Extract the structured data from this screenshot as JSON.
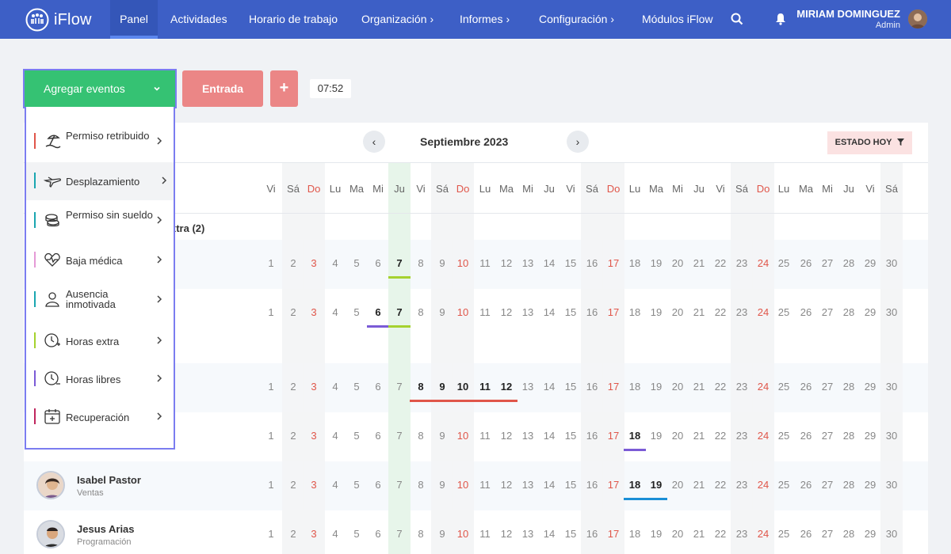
{
  "app": {
    "name": "iFlow"
  },
  "nav": {
    "items": [
      {
        "label": "Panel"
      },
      {
        "label": "Actividades"
      },
      {
        "label": "Horario de trabajo"
      },
      {
        "label": "Organización"
      },
      {
        "label": "Informes"
      },
      {
        "label": "Configuración"
      },
      {
        "label": "Módulos iFlow"
      }
    ],
    "chevron": "›",
    "user": {
      "name": "MIRIAM DOMINGUEZ",
      "role": "Admin"
    }
  },
  "toolbar": {
    "add_events": "Agregar eventos",
    "entry": "Entrada",
    "plus": "+",
    "time": "07:52"
  },
  "event_menu": {
    "items": [
      {
        "label": "Permiso retribuido",
        "color": "#e0564a",
        "icon": "beach-icon"
      },
      {
        "label": "Desplazamiento",
        "color": "#1aa6b0",
        "icon": "airplane-icon"
      },
      {
        "label": "Permiso sin sueldo",
        "color": "#1aa6b0",
        "icon": "coins-icon"
      },
      {
        "label": "Baja médica",
        "color": "#e59ad6",
        "icon": "heart-pulse-icon"
      },
      {
        "label": "Ausencia inmotivada",
        "color": "#1aa6b0",
        "icon": "person-icon"
      },
      {
        "label": "Horas extra",
        "color": "#a5d22e",
        "icon": "clock-plus-icon"
      },
      {
        "label": "Horas libres",
        "color": "#7b5bd6",
        "icon": "clock-minus-icon"
      },
      {
        "label": "Recuperación",
        "color": "#c0265e",
        "icon": "calendar-plus-icon"
      }
    ]
  },
  "calendar": {
    "month": "Septiembre 2023",
    "status_button": "ESTADO HOY",
    "prev": "‹",
    "next": "›",
    "weekdays": [
      "Vi",
      "Sá",
      "Do",
      "Lu",
      "Ma",
      "Mi",
      "Ju",
      "Vi",
      "Sá",
      "Do",
      "Lu",
      "Ma",
      "Mi",
      "Ju",
      "Vi",
      "Sá",
      "Do",
      "Lu",
      "Ma",
      "Mi",
      "Ju",
      "Vi",
      "Sá",
      "Do",
      "Lu",
      "Ma",
      "Mi",
      "Ju",
      "Vi",
      "Sá"
    ],
    "days": [
      "1",
      "2",
      "3",
      "4",
      "5",
      "6",
      "7",
      "8",
      "9",
      "10",
      "11",
      "12",
      "13",
      "14",
      "15",
      "16",
      "17",
      "18",
      "19",
      "20",
      "21",
      "22",
      "23",
      "24",
      "25",
      "26",
      "27",
      "28",
      "29",
      "30"
    ],
    "group_label": "xtra (2)",
    "people": [
      {
        "name": "Isabel Pastor",
        "dept": "Ventas"
      },
      {
        "name": "Jesus Arias",
        "dept": "Programación"
      }
    ]
  },
  "colors": {
    "nav": "#3d5fc6",
    "add_button": "#35c273",
    "entry_button": "#eb8686",
    "today_column": "#e7f5ea",
    "weekend_red": "#e0564a",
    "menu_border": "#7b7df0"
  }
}
